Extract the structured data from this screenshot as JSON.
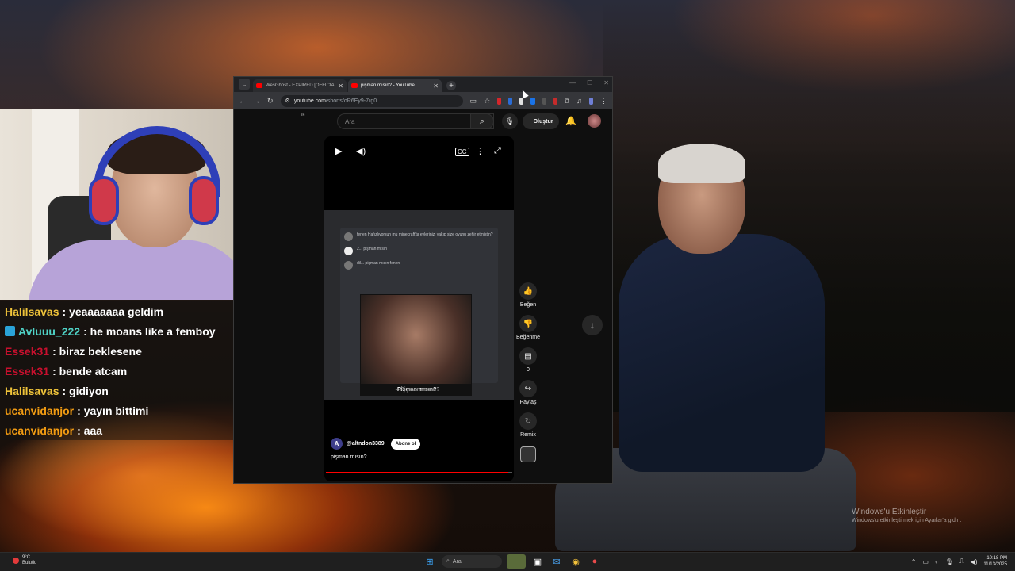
{
  "browser": {
    "tabs": [
      {
        "title": "WesGhost - EXPIRED [OFFICIAL",
        "active": false
      },
      {
        "title": "pişman mısın? - YouTube",
        "active": true
      }
    ],
    "url_host": "youtube.com",
    "url_path": "/shorts/oR6Ey9-7rg0"
  },
  "youtube": {
    "logo_suffix": "TR",
    "search_placeholder": "Ara",
    "create_label": "Oluştur",
    "short": {
      "channel": "@altndon3389",
      "channel_initial": "A",
      "subscribe_label": "Abone ol",
      "title": "pişman mısın?",
      "meme_caption": "-Pişman mısın?",
      "frame_subtitle": "-Pişman mısın?",
      "progress": 0.98,
      "discord_lines": [
        "fenen  Hafızlıyorsun mu minecraft'ta evlerinizi yakıp size oyunu zehir etmiştin?",
        "2...  pişman mısın",
        "dil...  pişman mısın  fenen"
      ]
    },
    "actions": [
      {
        "icon": "like-icon",
        "label": "Beğen"
      },
      {
        "icon": "dislike-icon",
        "label": "Beğenme"
      },
      {
        "icon": "comment-icon",
        "label": "0"
      },
      {
        "icon": "share-icon",
        "label": "Paylaş"
      },
      {
        "icon": "remix-icon",
        "label": "Remix"
      }
    ]
  },
  "chat": [
    {
      "user": "Halilsavas",
      "color": "#f0c43a",
      "message": ": yeaaaaaaa geldim",
      "badge": false
    },
    {
      "user": "Avluuu_222",
      "color": "#4fd1c5",
      "message": ": he moans like a femboy",
      "badge": true
    },
    {
      "user": "Essek31",
      "color": "#c8102e",
      "message": ": biraz beklesene",
      "badge": false
    },
    {
      "user": "Essek31",
      "color": "#c8102e",
      "message": ": bende atcam",
      "badge": false
    },
    {
      "user": "Halilsavas",
      "color": "#f0c43a",
      "message": ": gidiyon",
      "badge": false
    },
    {
      "user": "ucanvidanjor",
      "color": "#f39c12",
      "message": ": yayın bittimi",
      "badge": false
    },
    {
      "user": "ucanvidanjor",
      "color": "#f39c12",
      "message": ": aaa",
      "badge": false
    }
  ],
  "watermark": {
    "line1": "Windows'u Etkinleştir",
    "line2": "Windows'u etkinleştirmek için Ayarlar'a gidin."
  },
  "taskbar": {
    "weather_temp": "9°C",
    "weather_desc": "Bulutlu",
    "search_label": "Ara",
    "time": "10:18 PM",
    "date": "11/13/2025"
  }
}
